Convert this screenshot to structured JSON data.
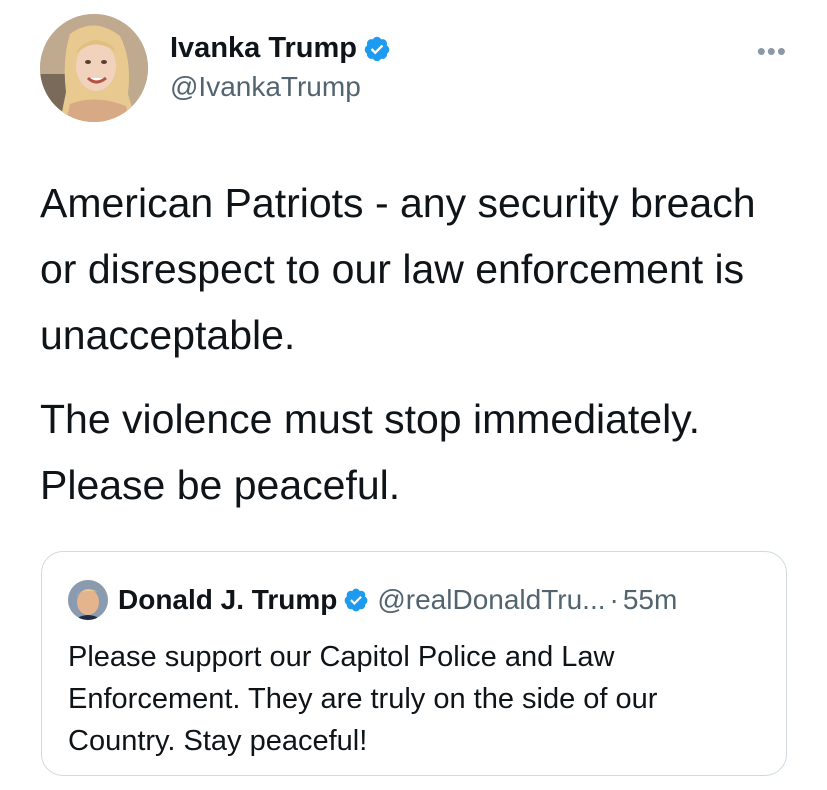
{
  "tweet": {
    "author": {
      "display_name": "Ivanka Trump",
      "handle": "@IvankaTrump",
      "verified_icon": "verified-badge-icon",
      "avatar": "profile-photo"
    },
    "more_label": "•••",
    "paragraphs": [
      "American Patriots - any security breach or disrespect to our law enforcement is unacceptable.",
      "The violence must stop immediately. Please be peaceful."
    ]
  },
  "quoted_tweet": {
    "display_name": "Donald J. Trump",
    "handle": "@realDonaldTru...",
    "separator": "·",
    "time": "55m",
    "text": "Please support our Capitol Police and Law Enforcement. They are truly on the side of our Country. Stay peaceful!"
  },
  "colors": {
    "verified": "#1d9bf0",
    "text_primary": "#0f1419",
    "text_secondary": "#536471",
    "border": "#cfd9de"
  }
}
